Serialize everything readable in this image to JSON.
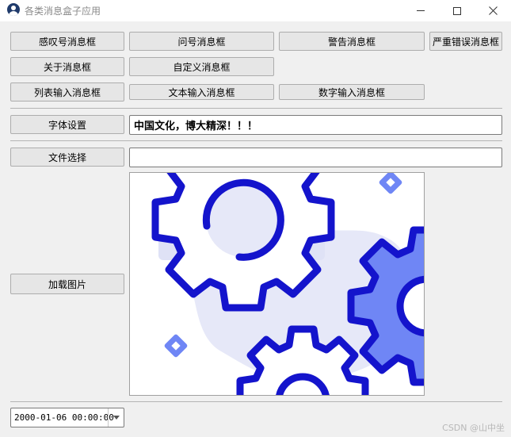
{
  "window": {
    "title": "各类消息盒子应用",
    "icon": "user-avatar-icon",
    "controls": [
      "minimize-icon",
      "maximize-icon",
      "close-icon"
    ]
  },
  "buttons": {
    "sigh": "感叹号消息框",
    "question": "问号消息框",
    "warning": "警告消息框",
    "critical": "严重错误消息框",
    "about": "关于消息框",
    "custom": "自定义消息框",
    "list_input": "列表输入消息框",
    "text_input": "文本输入消息框",
    "number_input": "数字输入消息框",
    "font_settings": "字体设置",
    "file_select": "文件选择",
    "load_image": "加载图片"
  },
  "font_field": {
    "value": "中国文化，博大精深！！！"
  },
  "file_field": {
    "value": ""
  },
  "image": {
    "subject": "gears-illustration",
    "colors": {
      "blue": "#1414cc",
      "light_blue": "#6f86f5",
      "bg_shape": "#e6e8f8"
    }
  },
  "datetime": {
    "value": "2000-01-06 00:00:00"
  },
  "watermark": {
    "text": "CSDN @山中坐"
  }
}
